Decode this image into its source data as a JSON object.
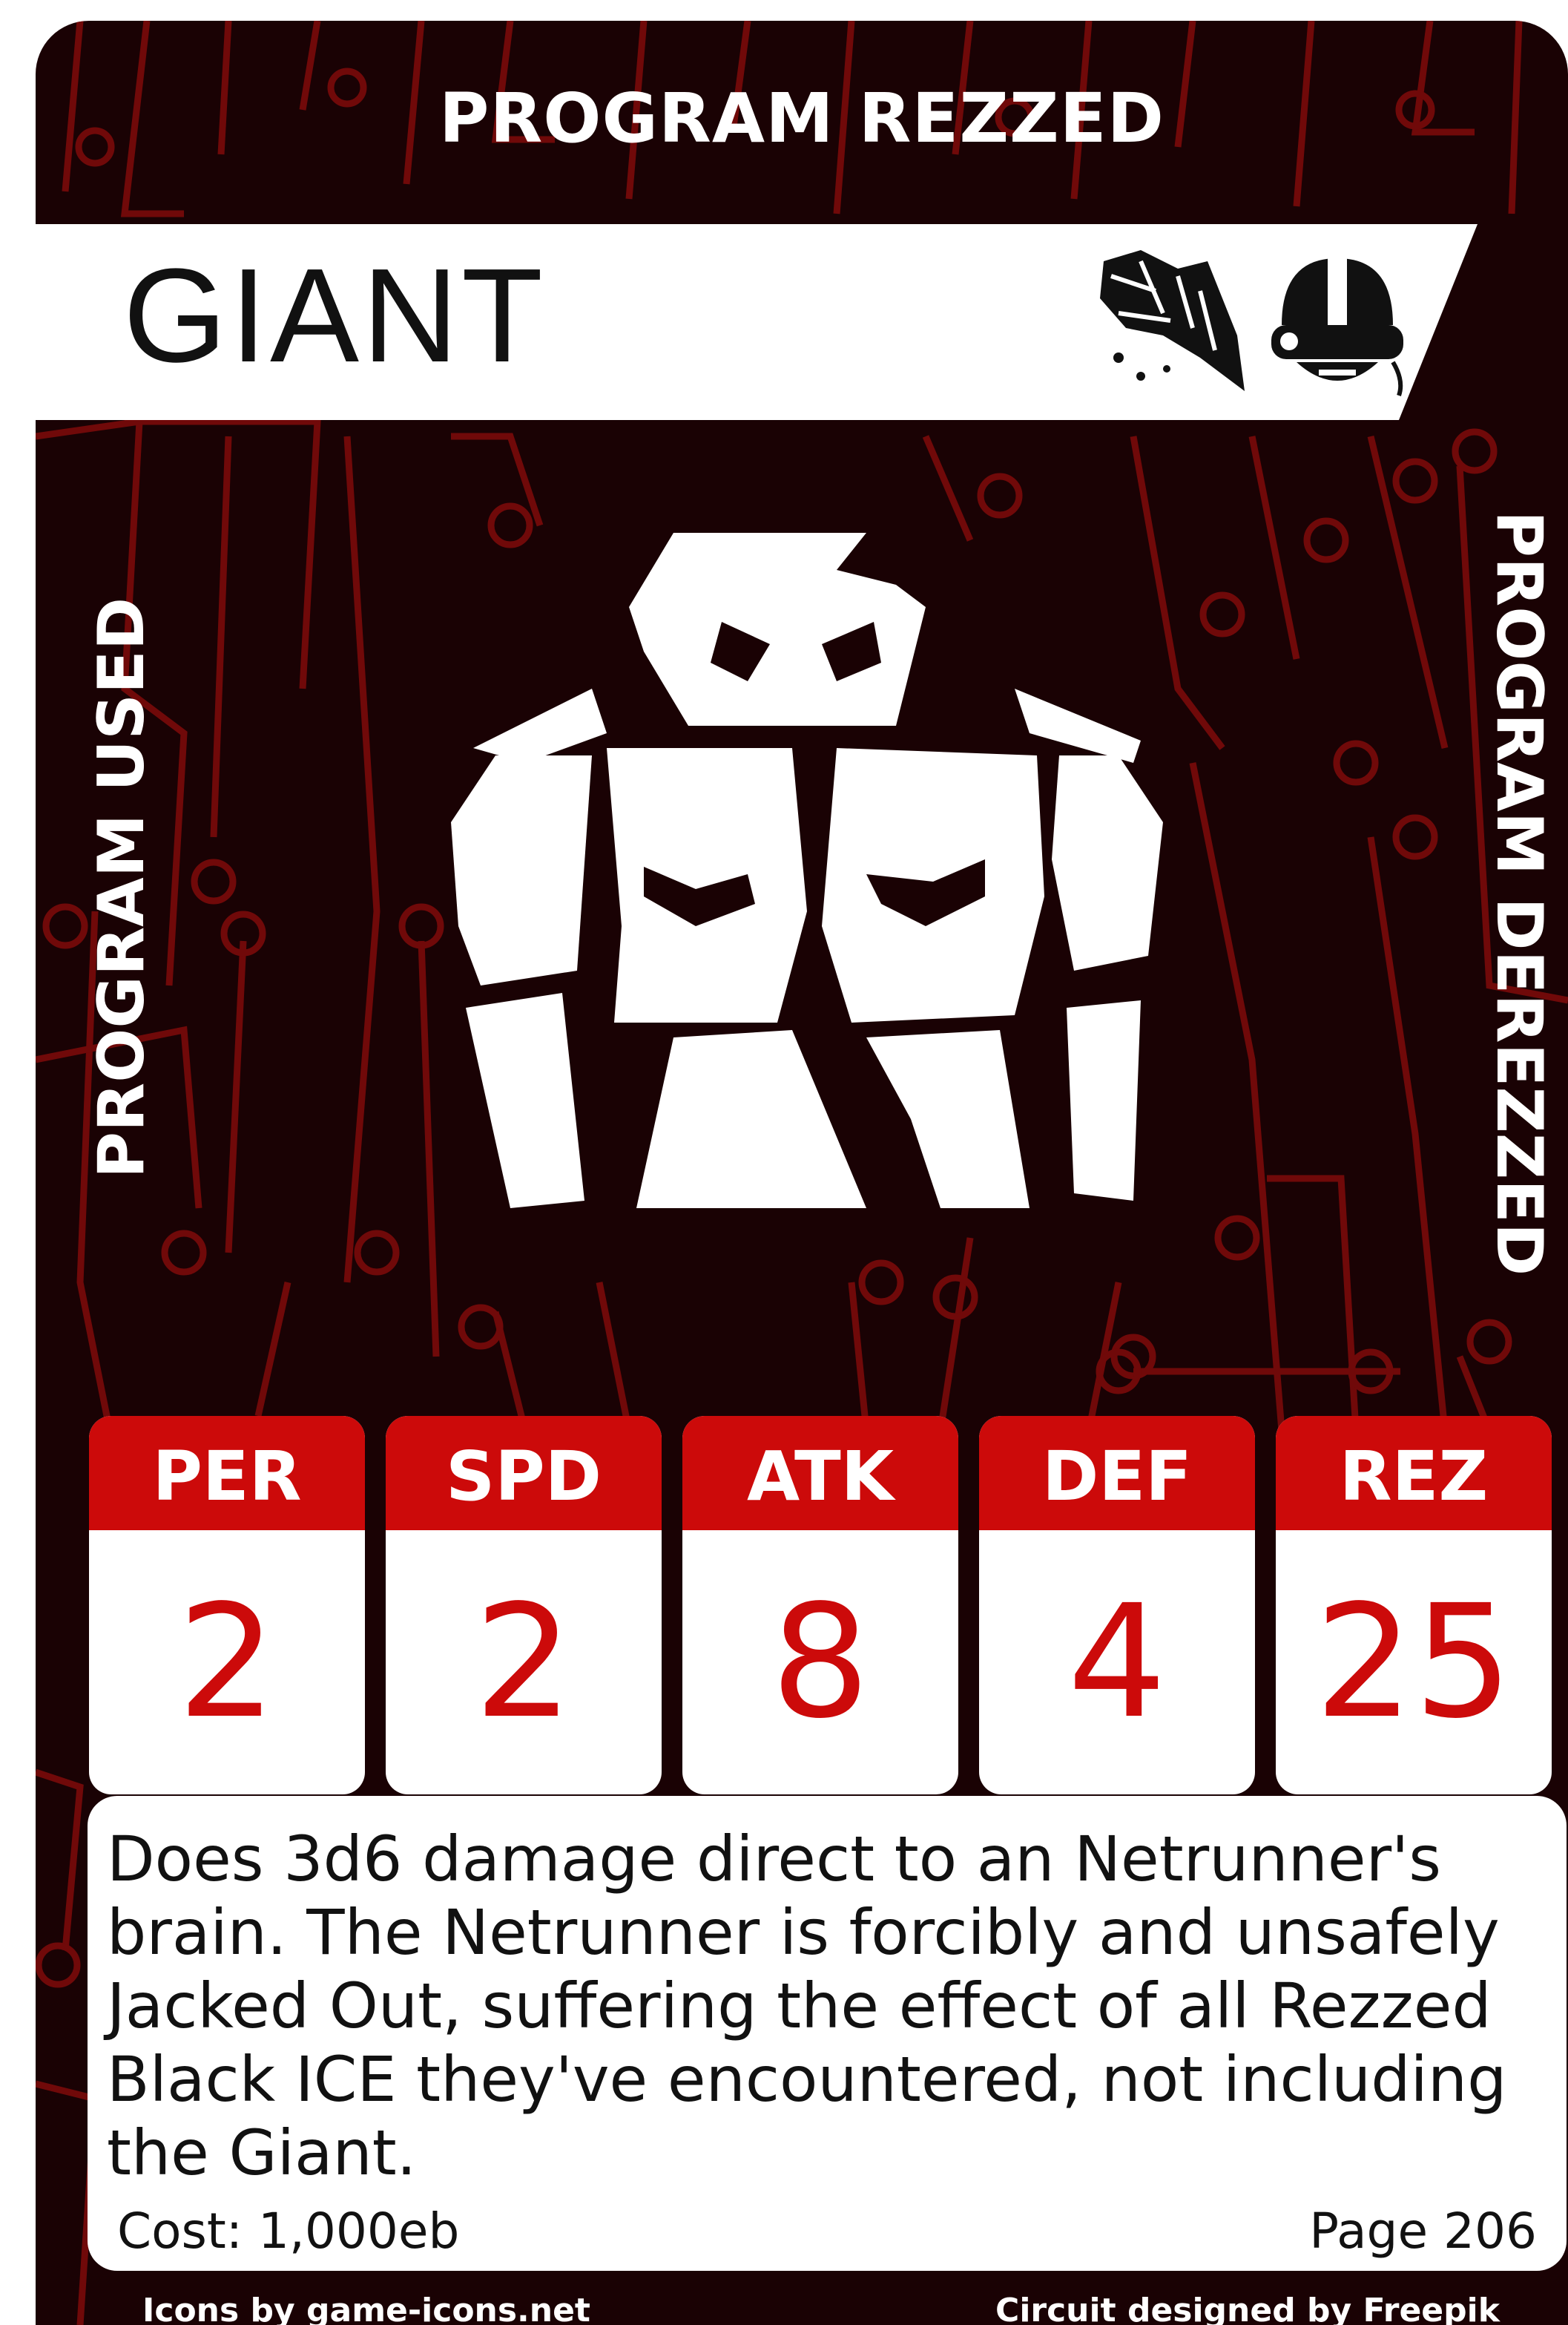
{
  "card": {
    "top_banner": "PROGRAM REZZED",
    "title": "GIANT",
    "left_side_label": "PROGRAM USED",
    "right_side_label": "PROGRAM DEREZZED",
    "header_icons": [
      "shatter-icon",
      "netrunner-helmet-icon"
    ],
    "art_icon": "giant-icon",
    "stats": [
      {
        "label": "PER",
        "value": "2"
      },
      {
        "label": "SPD",
        "value": "2"
      },
      {
        "label": "ATK",
        "value": "8"
      },
      {
        "label": "DEF",
        "value": "4"
      },
      {
        "label": "REZ",
        "value": "25"
      }
    ],
    "description": "Does 3d6 damage direct to an Netrunner's brain. The Netrunner is forcibly and unsafely Jacked Out, suffering the effect of all Rezzed Black ICE they've encountered, not including the Giant.",
    "cost": "Cost: 1,000eb",
    "page": "Page 206",
    "credit_left": "Icons by game-icons.net",
    "credit_right": "Circuit designed by Freepik"
  },
  "colors": {
    "background": "#1a0204",
    "circuit": "#8a0c0c",
    "accent_red": "#cc0a0a",
    "text_dark": "#111111"
  }
}
